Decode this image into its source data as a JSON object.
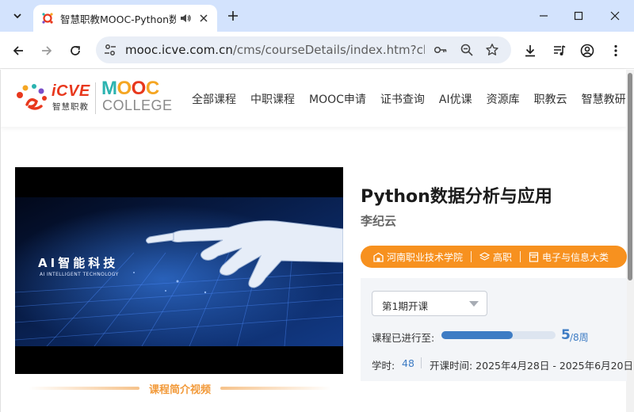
{
  "browser": {
    "tab_title": "智慧职教MOOC-Python数据分析与应用",
    "url_main": "mooc.icve.com.cn",
    "url_rest": "/cms/courseDetails/index.htm?classI..."
  },
  "site": {
    "logo_icve": "iCVE",
    "logo_icve_sub": "智慧职教",
    "logo_mooc": "MOOC",
    "logo_college": "COLLEGE",
    "nav": [
      "全部课程",
      "中职课程",
      "MOOC申请",
      "证书查询",
      "AI优课",
      "资源库",
      "职教云",
      "智慧教研"
    ]
  },
  "video": {
    "overlay_title": "AI智能科技",
    "overlay_subtitle": "AI INTELLIGENT TECHNOLOGY",
    "caption": "课程简介视频"
  },
  "course": {
    "title": "Python数据分析与应用",
    "teacher": "李纪云",
    "tags": {
      "school": "河南职业技术学院",
      "level": "高职",
      "category": "电子与信息大类"
    },
    "term_selected": "第1期开课",
    "progress_label": "课程已进行至:",
    "progress_current": "5",
    "progress_total": "/8周",
    "progress_fraction": 0.625,
    "hours_label": "学时:",
    "hours_value": "48",
    "period": "开课时间: 2025年4月28日 - 2025年6月20日"
  },
  "colors": {
    "accent_orange": "#f7911f",
    "accent_blue": "#3e7cc4",
    "icve_red": "#e8381d"
  },
  "icons": [
    "chevron-down-icon",
    "speaker-icon",
    "close-icon",
    "plus-icon",
    "minimize-icon",
    "maximize-icon",
    "back-icon",
    "forward-icon",
    "reload-icon",
    "site-info-icon",
    "password-key-icon",
    "zoom-icon",
    "star-icon",
    "download-icon",
    "media-icon",
    "profile-icon",
    "more-icon",
    "school-icon",
    "layers-icon",
    "book-icon"
  ]
}
